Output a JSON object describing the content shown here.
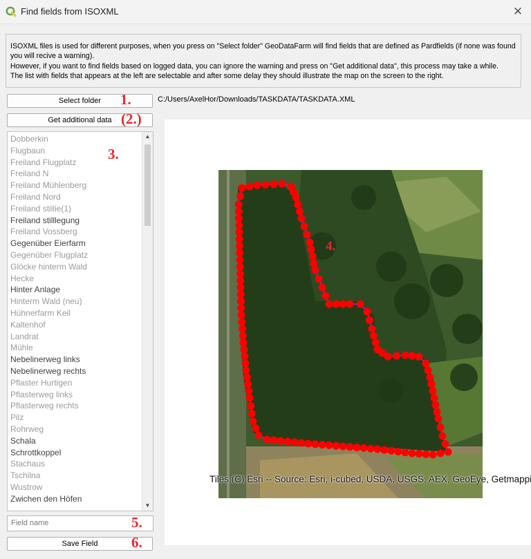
{
  "window": {
    "title": "Find fields from ISOXML",
    "close_symbol": "✕"
  },
  "info": {
    "line1": "ISOXML files is used for different purposes, when you press on \"Select folder\" GeoDataFarm will find fields that are defined as Pardfields (if none was found you will recive a warning).",
    "line2": "However, if you want to find fields based on logged data, you can ignore the warning and press on \"Get additional data\", this process may take a while.",
    "line3": "The list with fields that appears at the left are selectable and after some delay they should illustrate the map on the screen to the right."
  },
  "buttons": {
    "select_folder": "Select folder",
    "get_additional": "Get additional data",
    "save_field": "Save Field"
  },
  "path": "C:/Users/AxelHor/Downloads/TASKDATA/TASKDATA.XML",
  "markers": {
    "m1": "1.",
    "m2": "(2.)",
    "m3": "3.",
    "m4": "4.",
    "m5": "5.",
    "m6": "6."
  },
  "field_list": [
    "Dobberkin",
    "Flugbaun",
    "Freiland Flugplatz",
    "Freiland N",
    "Freiland Mühlenberg",
    "Freiland Nord",
    "Freiland stillie(1)",
    "Freiland stilllegung",
    "Freiland Vossberg",
    "Gegenüber Eierfarm",
    "Gegenüber Flugplatz",
    "Glöcke hinterm Wald",
    "Hecke",
    "Hinter Anlage",
    "Hinterm Wald (neu)",
    "Hühnerfarm Keil",
    "Kaltenhof",
    "Landrat",
    "Mühle",
    "Nebelinerweg links",
    "Nebelinerweg rechts",
    "Pflaster Hurtigen",
    "Pflasterweg links",
    "Pflasterweg rechts",
    "Pilz",
    "Rohrweg",
    "Schala",
    "Schrottkoppel",
    "Stachaus",
    "Tschilna",
    "Wustrow",
    "Zwichen den Höfen"
  ],
  "field_name_placeholder": "Field name",
  "map": {
    "attribution": "Tiles (C) Esri -- Source: Esri, i-cubed, USDA, USGS, AEX, GeoEye, Getmapping, Aerogrid, IGN, IGP, UPR-EGP, and the GIS User Community",
    "point_color": "#ff0000",
    "line_color": "#b21bd8"
  }
}
